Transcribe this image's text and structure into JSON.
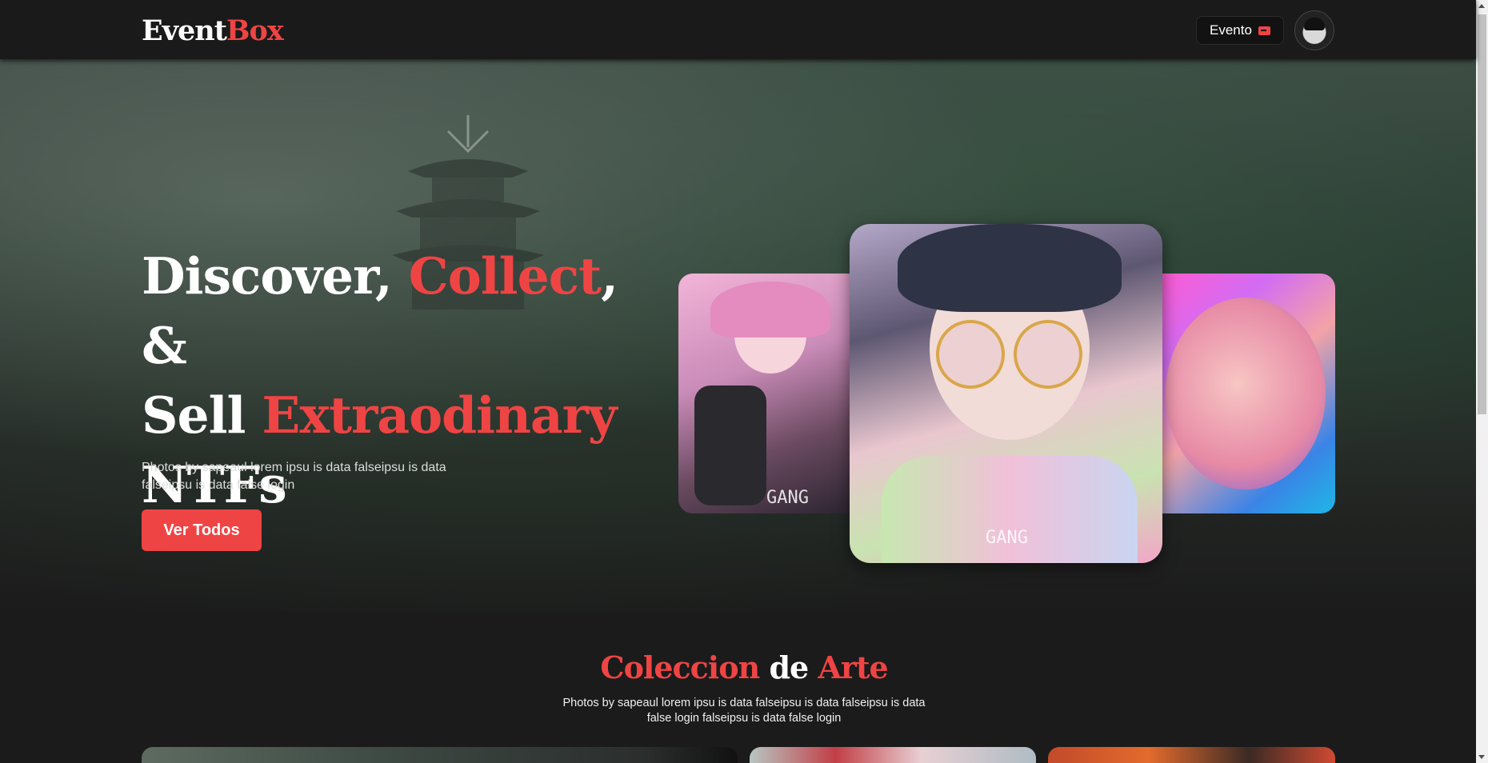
{
  "nav": {
    "logo_part1": "Event",
    "logo_part2": "Box",
    "evento_label": "Evento"
  },
  "hero": {
    "headline": [
      {
        "text": "Discover, ",
        "highlight": false
      },
      {
        "text": "Collect",
        "highlight": true
      },
      {
        "text": ", &",
        "highlight": false
      },
      {
        "text": "Sell ",
        "highlight": false
      },
      {
        "text": "Extraodinary",
        "highlight": true
      },
      {
        "text": "NTFs",
        "highlight": false
      }
    ],
    "description": "Photos by sapeaul lorem ipsu is data falseipsu is data falseipsu is data false login",
    "cta_label": "Ver Todos",
    "card_signature": "GANG"
  },
  "collection": {
    "title_part1": "Coleccion",
    "title_part2": "de",
    "title_part3": "Arte",
    "description": "Photos by sapeaul lorem ipsu is data falseipsu is data falseipsu is data false login falseipsu is data false login"
  },
  "colors": {
    "accent": "#ef4444",
    "background": "#1b1b1b",
    "navbar": "#1a1a1a"
  }
}
